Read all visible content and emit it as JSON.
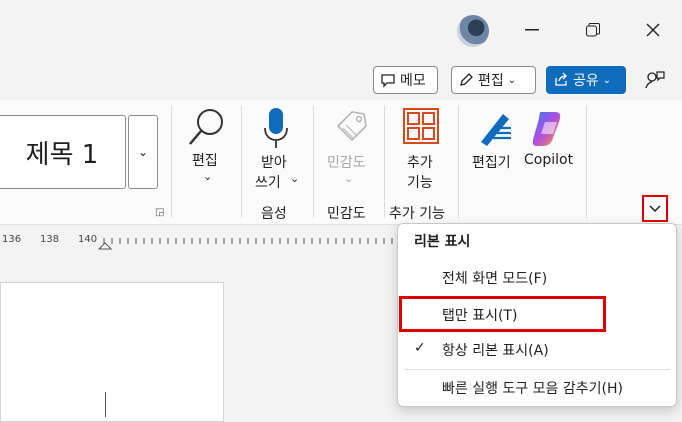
{
  "titlebar": {
    "minimize_icon": "minimize-icon",
    "restore_icon": "restore-icon",
    "close_icon": "close-icon"
  },
  "actions": {
    "comment_label": "메모",
    "edit_label": "편집",
    "share_label": "공유",
    "accent": "#0f6cbd"
  },
  "ribbon": {
    "style_gallery_value": "제목 1",
    "find_label": "편집",
    "dictate_label_line1": "받아",
    "dictate_label_line2": "쓰기",
    "sensitivity_label": "민감도",
    "addins_label_line1": "추가",
    "addins_label_line2": "기능",
    "editor_label": "편집기",
    "copilot_label": "Copilot",
    "group_voice": "음성",
    "group_sensitivity": "민감도",
    "group_addins": "추가 기능"
  },
  "ruler": {
    "marks": [
      "136",
      "138",
      "140"
    ]
  },
  "menu": {
    "title": "리본 표시",
    "items": [
      {
        "label": "전체 화면 모드(F)",
        "checked": false
      },
      {
        "label": "탭만 표시(T)",
        "checked": false
      },
      {
        "label": "항상 리본 표시(A)",
        "checked": true
      },
      {
        "label": "빠른 실행 도구 모음 감추기(H)",
        "checked": false
      }
    ],
    "check_glyph": "✓"
  },
  "highlight_color": "#e00000"
}
